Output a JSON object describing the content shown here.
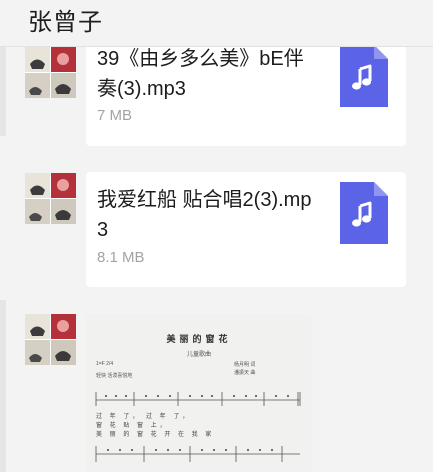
{
  "header": {
    "title": "张曾子"
  },
  "messages": [
    {
      "type": "file",
      "name": "39《由乡多么美》bE伴奏(3).mp3",
      "size": "7 MB",
      "icon": "music-note-icon"
    },
    {
      "type": "file",
      "name": "我爱红船 贴合唱2(3).mp3",
      "size": "8.1 MB",
      "icon": "music-note-icon"
    },
    {
      "type": "image",
      "sheet": {
        "title": "美丽的窗花",
        "subtitle": "儿童歌曲",
        "credit_lyrics": "杨月明 词",
        "credit_music": "潘振天 曲",
        "key": "1=F 2/4",
        "tempo": "轻快 活泼喜悦地",
        "lyric_line_1": "过 年 了， 过 年 了，",
        "lyric_line_2": "窗 花 贴 窗 上，",
        "lyric_line_3": "美 丽 的 窗 花 开 在 我 家"
      }
    }
  ],
  "colors": {
    "file_icon": "#5b64e6",
    "file_icon_fold": "#8f95f0",
    "card_bg": "#ffffff",
    "page_bg": "#f3f3f3",
    "size_text": "#a3a3a3"
  }
}
